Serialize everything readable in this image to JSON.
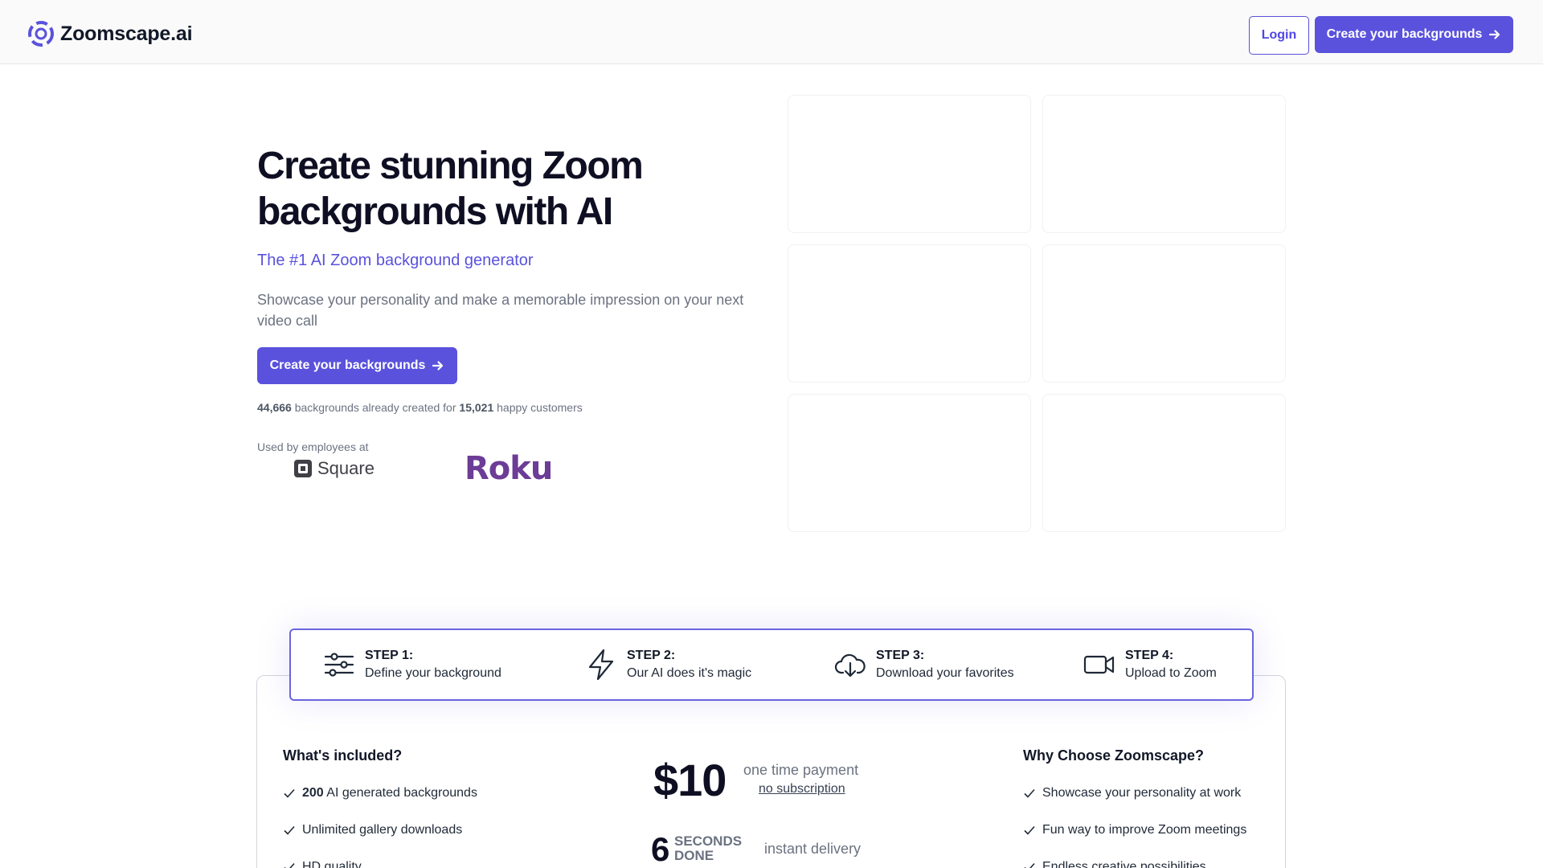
{
  "header": {
    "brand": "Zoomscape.ai",
    "login_label": "Login",
    "cta_label": "Create your backgrounds"
  },
  "hero": {
    "title": "Create stunning Zoom backgrounds with AI",
    "subtitle": "The #1 AI Zoom background generator",
    "description": "Showcase your personality and make a memorable impression on your next video call",
    "cta_label": "Create your backgrounds",
    "stats": {
      "backgrounds_count": "44,666",
      "backgrounds_text": "backgrounds already created for",
      "customers_count": "15,021",
      "customers_text": "happy customers"
    },
    "used_by_label": "Used by employees at",
    "company_logos": [
      "Square",
      "Roku"
    ]
  },
  "steps": [
    {
      "title": "STEP 1:",
      "desc": "Define your background",
      "icon": "sliders-icon"
    },
    {
      "title": "STEP 2:",
      "desc": "Our AI does it's magic",
      "icon": "lightning-icon"
    },
    {
      "title": "STEP 3:",
      "desc": "Download your favorites",
      "icon": "cloud-download-icon"
    },
    {
      "title": "STEP 4:",
      "desc": "Upload to Zoom",
      "icon": "video-camera-icon"
    }
  ],
  "included": {
    "heading": "What's included?",
    "items": [
      {
        "bold": "200",
        "text": "AI generated backgrounds"
      },
      {
        "bold": "",
        "text": "Unlimited gallery downloads"
      },
      {
        "bold": "",
        "text": "HD quality"
      }
    ]
  },
  "pricing": {
    "price": "$10",
    "note": "one time payment",
    "link": "no subscription",
    "delivery_number": "6",
    "delivery_unit_1": "SECONDS",
    "delivery_unit_2": "DONE",
    "delivery_text": "instant delivery"
  },
  "why": {
    "heading": "Why Choose Zoomscape?",
    "items": [
      "Showcase your personality at work",
      "Fun way to improve Zoom meetings",
      "Endless creative possibilities"
    ]
  },
  "colors": {
    "accent": "#5a52dc",
    "roku": "#6c3c97"
  }
}
